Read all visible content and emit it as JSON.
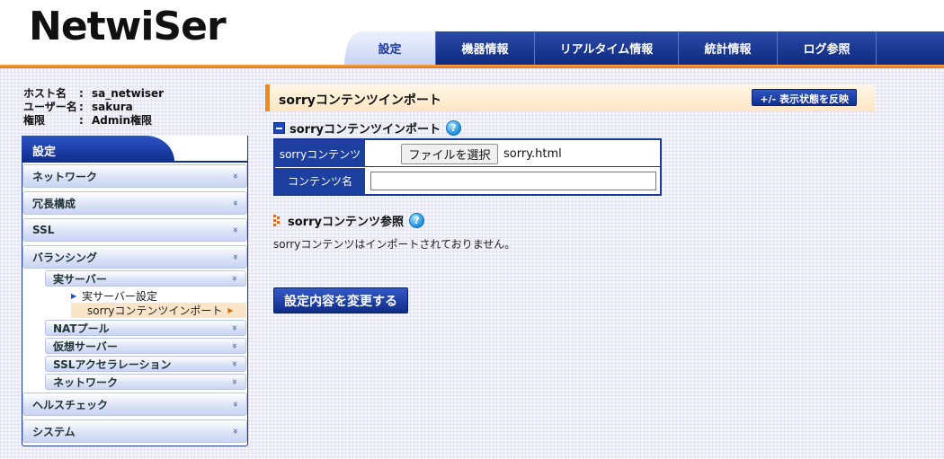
{
  "header": {
    "logo": "NetwiSer",
    "nav": {
      "settings": "設定",
      "devices": "機器情報",
      "realtime": "リアルタイム情報",
      "stats": "統計情報",
      "logs": "ログ参照"
    }
  },
  "userinfo": {
    "host_label": "ホスト名",
    "host_value": "sa_netwiser",
    "user_label": "ユーザー名",
    "user_value": "sakura",
    "role_label": "権限",
    "role_value": "Admin権限",
    "sep": ":"
  },
  "sidebar": {
    "title": "設定",
    "network": "ネットワーク",
    "redundancy": "冗長構成",
    "ssl": "SSL",
    "balancing": "バランシング",
    "real_server": "実サーバー",
    "real_server_settings": "実サーバー設定",
    "sorry_import": "sorryコンテンツインポート",
    "nat_pool": "NATプール",
    "virtual_server": "仮想サーバー",
    "ssl_accel": "SSLアクセラレーション",
    "sub_network": "ネットワーク",
    "health_check": "ヘルスチェック",
    "system": "システム",
    "chevron": "»"
  },
  "main": {
    "title": "sorryコンテンツインポート",
    "toggle_button": "+/- 表示状態を反映",
    "section_import": "sorryコンテンツインポート",
    "help": "?",
    "form": {
      "sorry_label": "sorryコンテンツ",
      "file_button": "ファイルを選択",
      "file_name": "sorry.html",
      "content_name_label": "コンテンツ名",
      "content_name_value": ""
    },
    "section_view": "sorryコンテンツ参照",
    "no_import_text": "sorryコンテンツはインポートされておりません。",
    "submit_button": "設定内容を変更する"
  },
  "colors": {
    "nav_blue": "#0f2a7f",
    "accent_orange": "#e07a12",
    "label_blue": "#1d3f9f"
  }
}
